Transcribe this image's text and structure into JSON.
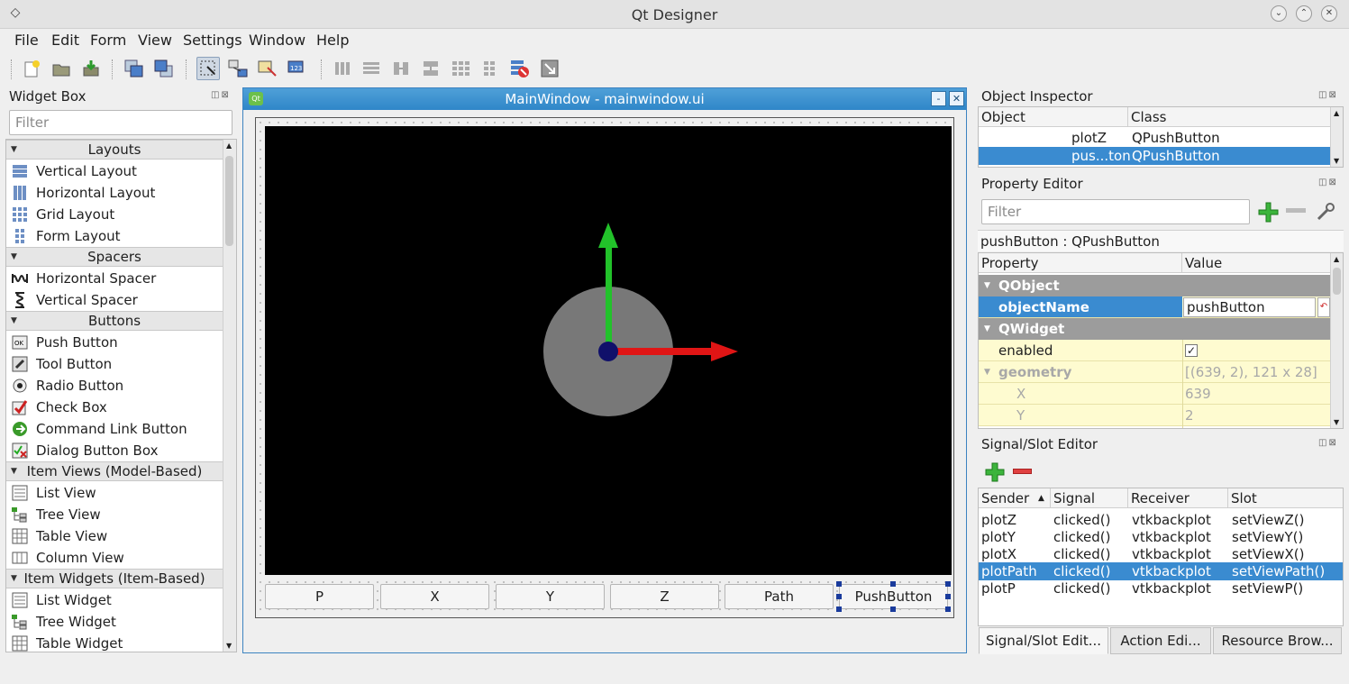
{
  "window": {
    "title": "Qt Designer"
  },
  "menu": [
    "File",
    "Edit",
    "Form",
    "View",
    "Settings",
    "Window",
    "Help"
  ],
  "widget_box": {
    "title": "Widget Box",
    "filter_placeholder": "Filter",
    "categories": [
      {
        "label": "Layouts",
        "items": [
          "Vertical Layout",
          "Horizontal Layout",
          "Grid Layout",
          "Form Layout"
        ]
      },
      {
        "label": "Spacers",
        "items": [
          "Horizontal Spacer",
          "Vertical Spacer"
        ]
      },
      {
        "label": "Buttons",
        "items": [
          "Push Button",
          "Tool Button",
          "Radio Button",
          "Check Box",
          "Command Link Button",
          "Dialog Button Box"
        ]
      },
      {
        "label": "Item Views (Model-Based)",
        "items": [
          "List View",
          "Tree View",
          "Table View",
          "Column View"
        ]
      },
      {
        "label": "Item Widgets (Item-Based)",
        "items": [
          "List Widget",
          "Tree Widget",
          "Table Widget"
        ]
      }
    ]
  },
  "form": {
    "title": "MainWindow - mainwindow.ui",
    "buttons": [
      "P",
      "X",
      "Y",
      "Z",
      "Path",
      "PushButton"
    ],
    "selected_button": "PushButton"
  },
  "object_inspector": {
    "title": "Object Inspector",
    "columns": [
      "Object",
      "Class"
    ],
    "rows": [
      {
        "object": "plotZ",
        "class": "QPushButton"
      },
      {
        "object": "pus...ton",
        "class": "QPushButton"
      }
    ]
  },
  "property_editor": {
    "title": "Property Editor",
    "filter_placeholder": "Filter",
    "subtitle": "pushButton : QPushButton",
    "columns": [
      "Property",
      "Value"
    ],
    "groups": {
      "qobject": "QObject",
      "qwidget": "QWidget"
    },
    "object_name": {
      "name": "objectName",
      "value": "pushButton"
    },
    "enabled": {
      "name": "enabled",
      "value": "✓"
    },
    "geometry": {
      "name": "geometry",
      "value": "[(639, 2), 121 x 28]"
    },
    "x": {
      "name": "X",
      "value": "639"
    },
    "y": {
      "name": "Y",
      "value": "2"
    }
  },
  "signal_slot": {
    "title": "Signal/Slot Editor",
    "columns": [
      "Sender",
      "Signal",
      "Receiver",
      "Slot"
    ],
    "rows": [
      {
        "sender": "plotZ",
        "signal": "clicked()",
        "receiver": "vtkbackplot",
        "slot": "setViewZ()"
      },
      {
        "sender": "plotY",
        "signal": "clicked()",
        "receiver": "vtkbackplot",
        "slot": "setViewY()"
      },
      {
        "sender": "plotX",
        "signal": "clicked()",
        "receiver": "vtkbackplot",
        "slot": "setViewX()"
      },
      {
        "sender": "plotPath",
        "signal": "clicked()",
        "receiver": "vtkbackplot",
        "slot": "setViewPath()"
      },
      {
        "sender": "plotP",
        "signal": "clicked()",
        "receiver": "vtkbackplot",
        "slot": "setViewP()"
      }
    ],
    "selected_row": 3,
    "tabs": [
      "Signal/Slot Edit...",
      "Action Edi...",
      "Resource Brow..."
    ]
  },
  "colors": {
    "selection": "#3a8bd0",
    "property_yellow": "#fefbd0",
    "axis_green": "#22c22a",
    "axis_red": "#e01515",
    "sphere": "#787878"
  }
}
